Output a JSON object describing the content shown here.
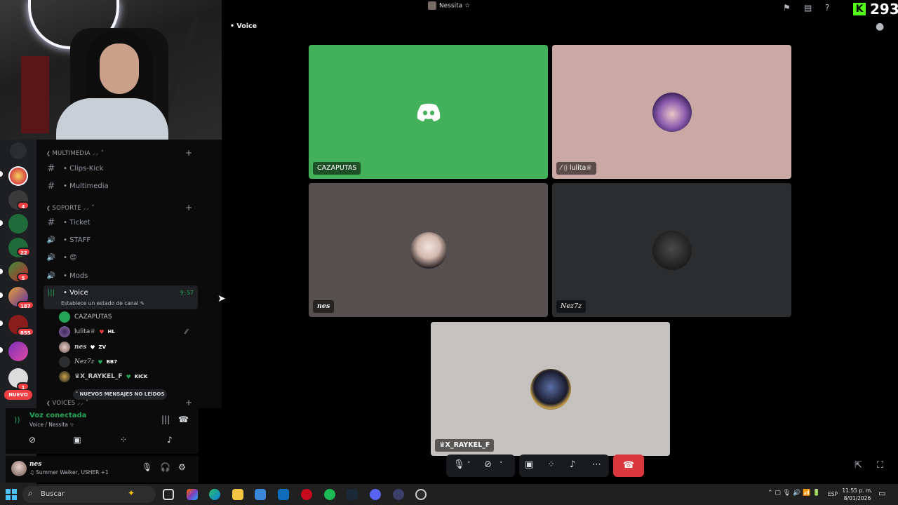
{
  "stage": {
    "window_title": "Nessita ☆",
    "channel_label": "• Voice",
    "viewer_count": "293",
    "kick_badge": "K"
  },
  "tiles": [
    {
      "label": "CAZAPUTAS",
      "bg": "#43b15a"
    },
    {
      "label": "lulita♕",
      "bg": "#caa9a4"
    },
    {
      "label": "nes",
      "bg": "#55504f"
    },
    {
      "label": "Nez7z",
      "bg": "#2c2d2f"
    },
    {
      "label": "♛X_RAYKEL_F",
      "bg": "#c4c1bf"
    }
  ],
  "sidebar": {
    "cat_multimedia": "MULTIMEDIA ⸝⸝ ˅",
    "cat_soporte": "SOPORTE ⸝⸝ ˅",
    "cat_voices": "VOICES ⸝⸝ ˅",
    "channels": [
      {
        "icon": "#",
        "name": "• Clips-Kick"
      },
      {
        "icon": "#",
        "name": "• Multimedia"
      },
      {
        "icon": "#",
        "name": "• Ticket"
      },
      {
        "icon": "🔊",
        "name": "• STAFF"
      },
      {
        "icon": "🔊",
        "name": "• 😍"
      },
      {
        "icon": "🔊",
        "name": "• Mods"
      }
    ],
    "active_channel": {
      "name": "• Voice",
      "time": "9:57",
      "status": "Establece un estado de canal ✎"
    },
    "members": [
      {
        "name": "CAZAPUTAS",
        "tag": "",
        "heart": ""
      },
      {
        "name": "lulita♕",
        "tag": "HL",
        "heart": "♥"
      },
      {
        "name": "nes",
        "tag": "ZV",
        "heart": "♥"
      },
      {
        "name": "Nez7z",
        "tag": "BB7",
        "heart": "♥"
      },
      {
        "name": "♛X_RAYKEL_F",
        "tag": "KICK",
        "heart": "♥"
      }
    ],
    "new_messages": "˅ NUEVOS MENSAJES NO LEÍDOS",
    "nuevo": "NUEVO",
    "badges": [
      "4",
      "22",
      "5",
      "187",
      "855",
      "1"
    ]
  },
  "voice_panel": {
    "title": "Voz conectada",
    "subtitle": "Voice / Nessita ☆"
  },
  "user_bar": {
    "username": "nes",
    "activity": "♫ Summer Walker, USHER +1"
  },
  "taskbar": {
    "search_placeholder": "Buscar",
    "lang": "ESP",
    "time": "11:55 p. m.",
    "date": "8/01/2026"
  },
  "colors": {
    "accent_green": "#23a559",
    "hangup_red": "#da373c",
    "kick_green": "#53fc18"
  }
}
